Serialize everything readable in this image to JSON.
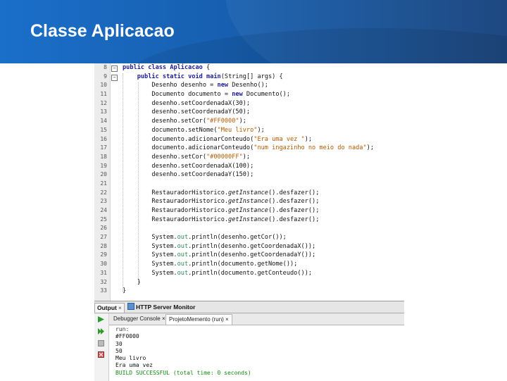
{
  "slide": {
    "title": "Classe Aplicacao"
  },
  "editor": {
    "lines": [
      {
        "num": "8",
        "code": [
          {
            "t": "public class",
            "c": "kw"
          },
          {
            "t": " "
          },
          {
            "t": "Aplicacao",
            "c": "kw"
          },
          {
            "t": " {"
          }
        ],
        "fold": true
      },
      {
        "num": "9",
        "code": [
          {
            "t": "    "
          },
          {
            "t": "public static void",
            "c": "kw"
          },
          {
            "t": " "
          },
          {
            "t": "main",
            "c": "kw"
          },
          {
            "t": "(String[] args) {"
          }
        ],
        "fold": true
      },
      {
        "num": "10",
        "code": [
          {
            "t": "        Desenho desenho = "
          },
          {
            "t": "new",
            "c": "kw"
          },
          {
            "t": " Desenho();"
          }
        ]
      },
      {
        "num": "11",
        "code": [
          {
            "t": "        Documento documento = "
          },
          {
            "t": "new",
            "c": "kw"
          },
          {
            "t": " Documento();"
          }
        ]
      },
      {
        "num": "12",
        "code": [
          {
            "t": "        desenho.setCoordenadaX(30);"
          }
        ]
      },
      {
        "num": "13",
        "code": [
          {
            "t": "        desenho.setCoordenadaY(50);"
          }
        ]
      },
      {
        "num": "14",
        "code": [
          {
            "t": "        desenho.setCor("
          },
          {
            "t": "\"#FF0000\"",
            "c": "str"
          },
          {
            "t": ");"
          }
        ]
      },
      {
        "num": "15",
        "code": [
          {
            "t": "        documento.setNome("
          },
          {
            "t": "\"Meu livro\"",
            "c": "str"
          },
          {
            "t": ");"
          }
        ]
      },
      {
        "num": "16",
        "code": [
          {
            "t": "        documento.adicionarConteudo("
          },
          {
            "t": "\"Era uma vez \"",
            "c": "str"
          },
          {
            "t": ");"
          }
        ]
      },
      {
        "num": "17",
        "code": [
          {
            "t": "        documento.adicionarConteudo("
          },
          {
            "t": "\"num ingazinho no meio do nada\"",
            "c": "str"
          },
          {
            "t": ");"
          }
        ]
      },
      {
        "num": "18",
        "code": [
          {
            "t": "        desenho.setCor("
          },
          {
            "t": "\"#00000FF\"",
            "c": "str"
          },
          {
            "t": ");"
          }
        ]
      },
      {
        "num": "19",
        "code": [
          {
            "t": "        desenho.setCoordenadaX(100);"
          }
        ]
      },
      {
        "num": "20",
        "code": [
          {
            "t": "        desenho.setCoordenadaY(150);"
          }
        ]
      },
      {
        "num": "21",
        "code": [
          {
            "t": ""
          }
        ]
      },
      {
        "num": "22",
        "code": [
          {
            "t": "        RestauradorHistorico."
          },
          {
            "t": "getInstance",
            "c": "it"
          },
          {
            "t": "().desfazer();"
          }
        ]
      },
      {
        "num": "23",
        "code": [
          {
            "t": "        RestauradorHistorico."
          },
          {
            "t": "getInstance",
            "c": "it"
          },
          {
            "t": "().desfazer();"
          }
        ]
      },
      {
        "num": "24",
        "code": [
          {
            "t": "        RestauradorHistorico."
          },
          {
            "t": "getInstance",
            "c": "it"
          },
          {
            "t": "().desfazer();"
          }
        ]
      },
      {
        "num": "25",
        "code": [
          {
            "t": "        RestauradorHistorico."
          },
          {
            "t": "getInstance",
            "c": "it"
          },
          {
            "t": "().desfazer();"
          }
        ]
      },
      {
        "num": "26",
        "code": [
          {
            "t": ""
          }
        ]
      },
      {
        "num": "27",
        "code": [
          {
            "t": "        System."
          },
          {
            "t": "out",
            "c": "fld"
          },
          {
            "t": ".println(desenho.getCor());"
          }
        ]
      },
      {
        "num": "28",
        "code": [
          {
            "t": "        System."
          },
          {
            "t": "out",
            "c": "fld"
          },
          {
            "t": ".println(desenho.getCoordenadaX());"
          }
        ]
      },
      {
        "num": "29",
        "code": [
          {
            "t": "        System."
          },
          {
            "t": "out",
            "c": "fld"
          },
          {
            "t": ".println(desenho.getCoordenadaY());"
          }
        ]
      },
      {
        "num": "30",
        "code": [
          {
            "t": "        System."
          },
          {
            "t": "out",
            "c": "fld"
          },
          {
            "t": ".println(documento.getNome());"
          }
        ]
      },
      {
        "num": "31",
        "code": [
          {
            "t": "        System."
          },
          {
            "t": "out",
            "c": "fld"
          },
          {
            "t": ".println(documento.getConteudo());"
          }
        ]
      },
      {
        "num": "32",
        "code": [
          {
            "t": "    }"
          }
        ]
      },
      {
        "num": "33",
        "code": [
          {
            "t": "}"
          }
        ]
      }
    ]
  },
  "output_panel": {
    "tabs": [
      {
        "label": "Output",
        "close": "×"
      },
      {
        "label": "HTTP Server Monitor",
        "close": ""
      }
    ],
    "subtabs": [
      {
        "label": "Debugger Console",
        "close": "×"
      },
      {
        "label": "ProjetoMemento (run)",
        "close": "×"
      }
    ],
    "console_lines": [
      {
        "text": "run:",
        "kind": "run"
      },
      {
        "text": "#FF0000",
        "kind": ""
      },
      {
        "text": "30",
        "kind": ""
      },
      {
        "text": "50",
        "kind": ""
      },
      {
        "text": "Meu livro",
        "kind": ""
      },
      {
        "text": "Era uma vez",
        "kind": ""
      },
      {
        "text": "BUILD SUCCESSFUL (total time: 0 seconds)",
        "kind": "ok"
      }
    ]
  },
  "colors": {
    "header_start": "#1a6fc9",
    "header_end": "#123f7a",
    "keyword": "#1a1a9c",
    "string": "#b35a00",
    "field": "#2e8b57",
    "success": "#138a13"
  }
}
